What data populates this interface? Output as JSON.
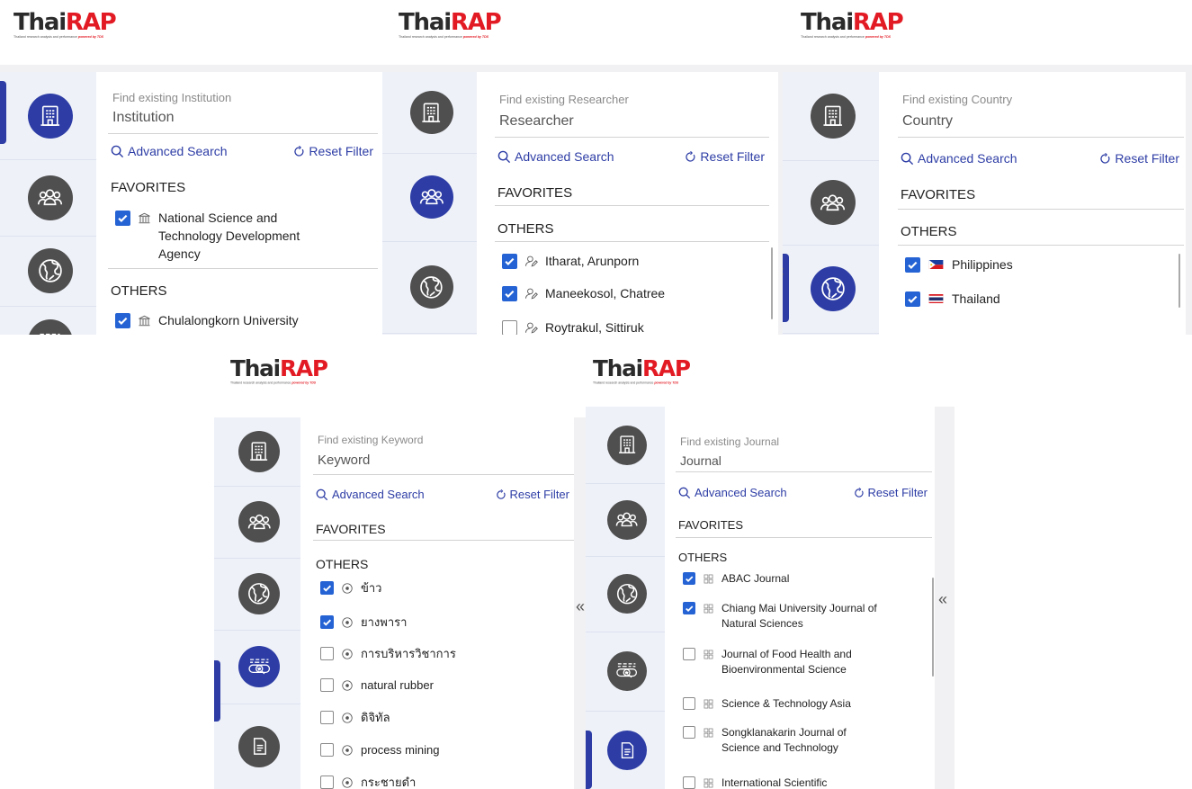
{
  "brand": {
    "name_dark": "Thai",
    "name_red": "RAP",
    "tagline": "Thailand research analysis and performance",
    "powered": "powered by TDS"
  },
  "colors": {
    "accent": "#2d3da5",
    "checkbox": "#2563d4",
    "brand_red": "#e21a23",
    "rail": "#eef1f8",
    "icon_dark": "#4f4f4f"
  },
  "rail_icons": [
    "institution-icon",
    "researchers-icon",
    "country-globe-icon",
    "keyword-search-icon",
    "journal-document-icon"
  ],
  "common": {
    "advanced_search": "Advanced Search",
    "reset_filter": "Reset Filter",
    "favorites": "FAVORITES",
    "others": "OTHERS",
    "collapse": "«"
  },
  "panels": [
    {
      "id": "institution",
      "hint": "Find existing Institution",
      "field": "Institution",
      "favorites": [
        {
          "label": "National Science and Technology Development Agency",
          "checked": true,
          "icon": "institution-building-icon"
        }
      ],
      "others": [
        {
          "label": "Chulalongkorn University",
          "checked": true,
          "icon": "institution-building-icon"
        }
      ]
    },
    {
      "id": "researcher",
      "hint": "Find existing Researcher",
      "field": "Researcher",
      "favorites": [],
      "others": [
        {
          "label": "Itharat, Arunporn",
          "checked": true,
          "icon": "person-edit-icon"
        },
        {
          "label": "Maneekosol, Chatree",
          "checked": true,
          "icon": "person-edit-icon"
        },
        {
          "label": "Roytrakul, Sittiruk",
          "checked": false,
          "icon": "person-edit-icon"
        }
      ]
    },
    {
      "id": "country",
      "hint": "Find existing Country",
      "field": "Country",
      "favorites": [],
      "others": [
        {
          "label": "Philippines",
          "checked": true,
          "icon": "philippines-flag-icon"
        },
        {
          "label": "Thailand",
          "checked": true,
          "icon": "thailand-flag-icon"
        }
      ]
    },
    {
      "id": "keyword",
      "hint": "Find existing Keyword",
      "field": "Keyword",
      "favorites": [],
      "others": [
        {
          "label": "ข้าว",
          "checked": true,
          "icon": "keyword-dot-icon"
        },
        {
          "label": "ยางพารา",
          "checked": true,
          "icon": "keyword-dot-icon"
        },
        {
          "label": "การบริหารวิชาการ",
          "checked": false,
          "icon": "keyword-dot-icon"
        },
        {
          "label": "natural rubber",
          "checked": false,
          "icon": "keyword-dot-icon"
        },
        {
          "label": "ดิจิทัล",
          "checked": false,
          "icon": "keyword-dot-icon"
        },
        {
          "label": "process mining",
          "checked": false,
          "icon": "keyword-dot-icon"
        },
        {
          "label": "กระชายดำ",
          "checked": false,
          "icon": "keyword-dot-icon"
        }
      ]
    },
    {
      "id": "journal",
      "hint": "Find existing Journal",
      "field": "Journal",
      "favorites": [],
      "others": [
        {
          "label": "ABAC Journal",
          "checked": true,
          "icon": "journal-grid-icon"
        },
        {
          "label": "Chiang Mai University Journal of Natural Sciences",
          "checked": true,
          "icon": "journal-grid-icon"
        },
        {
          "label": "Journal of Food Health and Bioenvironmental Science",
          "checked": false,
          "icon": "journal-grid-icon"
        },
        {
          "label": "Science & Technology Asia",
          "checked": false,
          "icon": "journal-grid-icon"
        },
        {
          "label": "Songklanakarin Journal of Science and Technology",
          "checked": false,
          "icon": "journal-grid-icon"
        },
        {
          "label": "International Scientific",
          "checked": false,
          "icon": "journal-grid-icon"
        }
      ]
    }
  ]
}
